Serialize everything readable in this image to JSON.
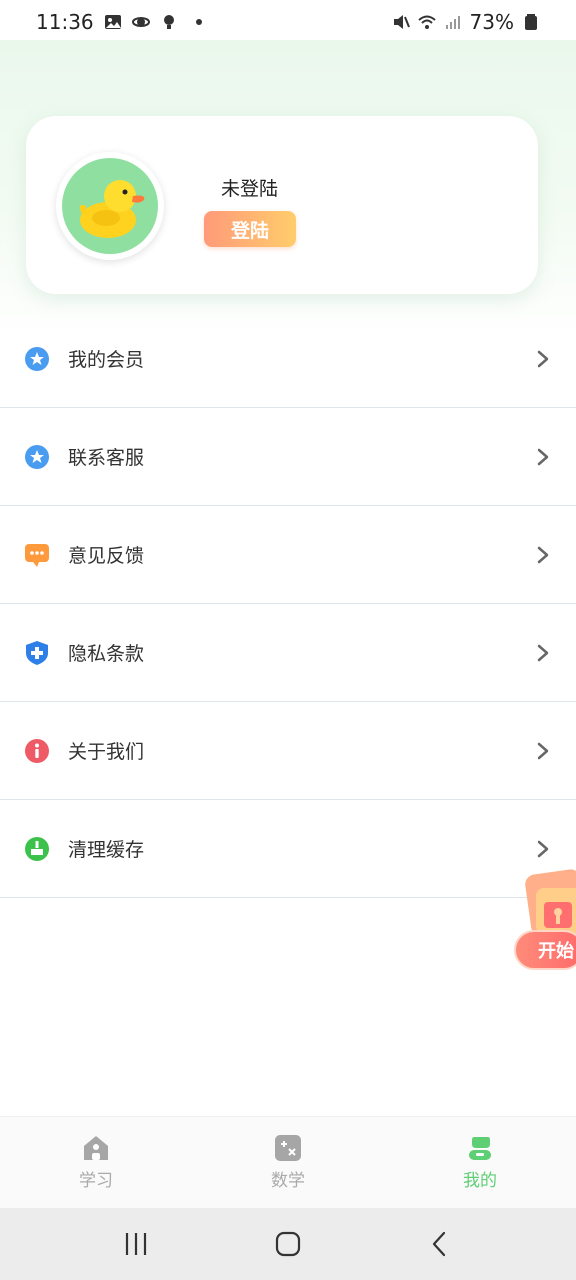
{
  "status": {
    "time": "11:36",
    "battery": "73%"
  },
  "profile": {
    "username": "未登陆",
    "login_label": "登陆"
  },
  "menu": {
    "items": [
      {
        "label": "我的会员",
        "icon": "star-badge-icon",
        "color": "#4a9cf0"
      },
      {
        "label": "联系客服",
        "icon": "star-badge-icon",
        "color": "#4a9cf0"
      },
      {
        "label": "意见反馈",
        "icon": "chat-bubble-icon",
        "color": "#ff9a3c"
      },
      {
        "label": "隐私条款",
        "icon": "shield-plus-icon",
        "color": "#2f7fe8"
      },
      {
        "label": "关于我们",
        "icon": "info-icon",
        "color": "#ee5a66"
      },
      {
        "label": "清理缓存",
        "icon": "broom-icon",
        "color": "#3cc24a"
      }
    ]
  },
  "promo": {
    "label": "开始"
  },
  "tabbar": {
    "tabs": [
      {
        "label": "学习",
        "icon": "house-icon",
        "active": false
      },
      {
        "label": "数学",
        "icon": "calculator-icon",
        "active": false
      },
      {
        "label": "我的",
        "icon": "profile-icon",
        "active": true
      }
    ]
  },
  "colors": {
    "accent": "#5ecf74",
    "login_gradient_start": "#ff9a7a",
    "login_gradient_end": "#ffcd6b"
  }
}
